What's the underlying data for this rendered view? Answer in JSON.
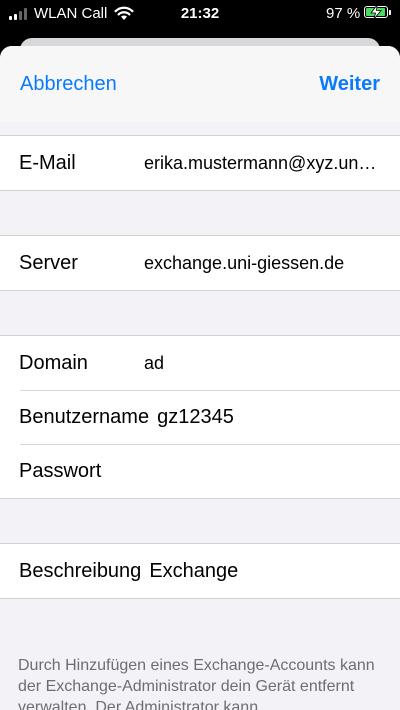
{
  "status_bar": {
    "carrier": "WLAN Call",
    "time": "21:32",
    "battery_percent": "97 %",
    "battery_level": 0.97,
    "icons": [
      "signal-icon",
      "wifi-icon",
      "battery-charging-icon"
    ]
  },
  "nav": {
    "cancel_label": "Abbrechen",
    "next_label": "Weiter"
  },
  "fields": {
    "email_label": "E-Mail",
    "email_value": "erika.mustermann@xyz.uni…",
    "server_label": "Server",
    "server_value": "exchange.uni-giessen.de",
    "domain_label": "Domain",
    "domain_value": "ad",
    "username_label": "Benutzername",
    "username_value": "gz12345",
    "password_label": "Passwort",
    "password_value": "",
    "description_label": "Beschreibung",
    "description_value": "Exchange"
  },
  "footer": {
    "text": "Durch Hinzufügen eines Exchange-Accounts kann der Exchange-Administrator dein Gerät entfernt verwalten. Der Administrator kann"
  },
  "colors": {
    "accent": "#0a7aff",
    "battery": "#4cd964",
    "background": "#f2f2f7"
  }
}
